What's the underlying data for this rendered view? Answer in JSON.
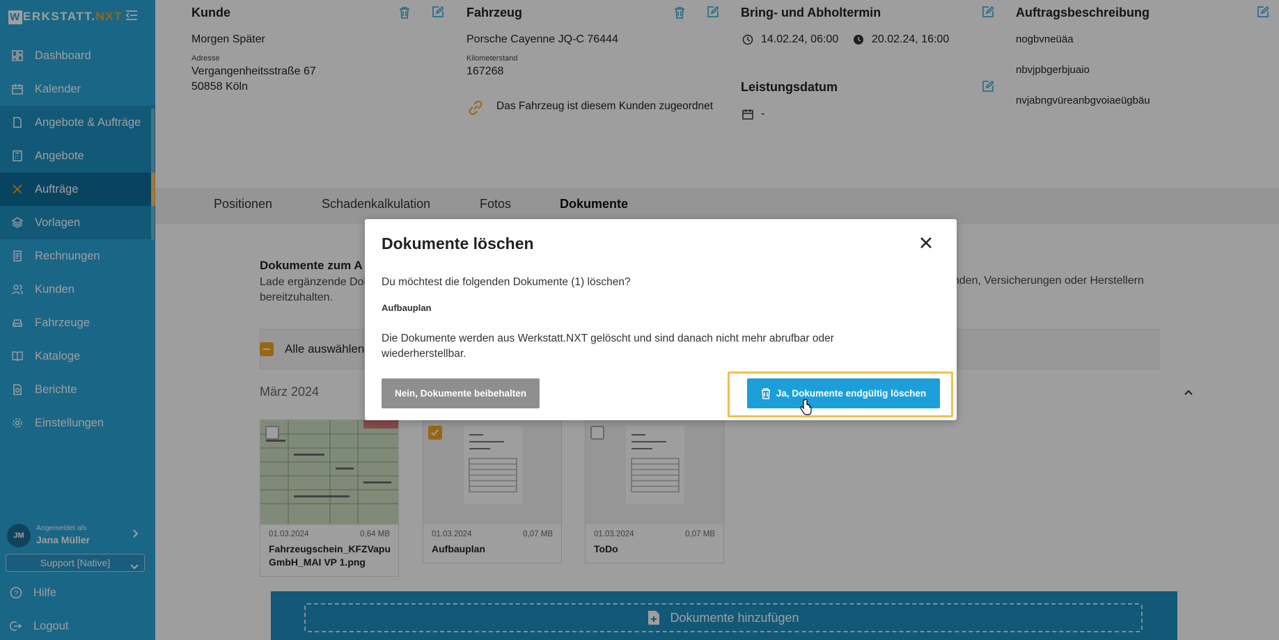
{
  "app": {
    "brand_first": "W",
    "brand_rest": "ERKSTATT.",
    "brand_nxt": "NXT"
  },
  "sidebar": {
    "items": [
      {
        "label": "Dashboard",
        "icon": "dashboard-icon"
      },
      {
        "label": "Kalender",
        "icon": "calendar-icon"
      },
      {
        "label": "Angebote & Aufträge",
        "icon": "document-icon"
      },
      {
        "label": "Angebote",
        "icon": "calculator-icon"
      },
      {
        "label": "Aufträge",
        "icon": "tools-icon"
      },
      {
        "label": "Vorlagen",
        "icon": "layers-icon"
      },
      {
        "label": "Rechnungen",
        "icon": "invoice-icon"
      },
      {
        "label": "Kunden",
        "icon": "users-icon"
      },
      {
        "label": "Fahrzeuge",
        "icon": "car-icon"
      },
      {
        "label": "Kataloge",
        "icon": "book-icon"
      },
      {
        "label": "Berichte",
        "icon": "report-icon"
      },
      {
        "label": "Einstellungen",
        "icon": "gear-icon"
      }
    ],
    "user": {
      "initials": "JM",
      "logged_in_label": "Angemeldet als",
      "name": "Jana Müller",
      "support_select": "Support [Native]"
    },
    "help_label": "Hilfe",
    "logout_label": "Logout"
  },
  "header": {
    "customer": {
      "title": "Kunde",
      "name": "Morgen Später",
      "address_label": "Adresse",
      "street": "Vergangenheitsstraße 67",
      "city": "50858 Köln"
    },
    "vehicle": {
      "title": "Fahrzeug",
      "name": "Porsche Cayenne JQ-C 76444",
      "mileage_label": "Kilometerstand",
      "mileage": "167268",
      "assigned_text": "Das Fahrzeug ist diesem Kunden zugeordnet"
    },
    "appointment": {
      "title": "Bring- und Abholtermin",
      "bring": "14.02.24, 06:00",
      "pickup": "20.02.24, 16:00",
      "service_date_title": "Leistungsdatum",
      "service_date": "-"
    },
    "description": {
      "title": "Auftragsbeschreibung",
      "lines": [
        "nogbvneüäa",
        "nbvjpbgerbjuaio",
        "nvjabngvüreanbgvoiaeügbäu"
      ]
    }
  },
  "tabs": [
    "Positionen",
    "Schadenkalkulation",
    "Fotos",
    "Dokumente"
  ],
  "documents": {
    "title": "Dokumente zum A",
    "desc_line1": "Lade ergänzende Dok",
    "desc_line1_end": "unden, Versicherungen oder Herstellern",
    "desc_line2": "bereitzuhalten.",
    "select_all": "Alle auswählen",
    "month": "März 2024",
    "files": [
      {
        "date": "01.03.2024",
        "size": "0,64 MB",
        "name": "Fahrzeugschein_KFZVapu GmbH_MAI VP 1.png",
        "checked": false
      },
      {
        "date": "01.03.2024",
        "size": "0,07 MB",
        "name": "Aufbauplan",
        "checked": true
      },
      {
        "date": "01.03.2024",
        "size": "0,07 MB",
        "name": "ToDo",
        "checked": false
      }
    ],
    "add_button": "Dokumente hinzufügen"
  },
  "modal": {
    "title": "Dokumente löschen",
    "question": "Du möchtest die folgenden Dokumente (1) löschen?",
    "doc_name": "Aufbauplan",
    "warning": "Die Dokumente werden aus Werkstatt.NXT gelöscht und sind danach nicht mehr abrufbar oder wiederherstellbar.",
    "keep_button": "Nein, Dokumente beibehalten",
    "delete_button": "Ja, Dokumente endgültig löschen"
  },
  "colors": {
    "sidebar": "#2aa5d9",
    "accent": "#f5a623",
    "primary_button": "#1c9fd8",
    "secondary_button": "#8f8f8f"
  }
}
